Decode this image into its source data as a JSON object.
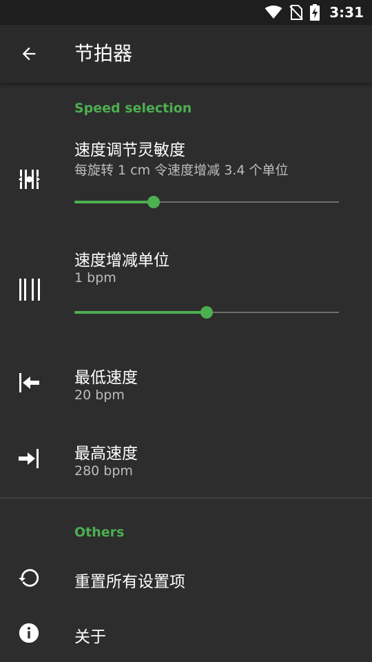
{
  "status_bar": {
    "time": "3:31",
    "icons": [
      "wifi-icon",
      "no-sim-icon",
      "battery-charging-icon"
    ]
  },
  "app_bar": {
    "back_icon": "arrow-left-icon",
    "title": "节拍器"
  },
  "sections": {
    "speed": {
      "header": "Speed selection",
      "sensitivity": {
        "icon": "sliders-icon",
        "title": "速度调节灵敏度",
        "summary": "每旋转 1 cm 令速度增减 3.4 个单位",
        "slider_fraction": 0.3
      },
      "step": {
        "icon": "bars-icon",
        "title": "速度增减单位",
        "summary": "1 bpm",
        "slider_fraction": 0.5
      },
      "min": {
        "icon": "arrow-to-left-icon",
        "title": "最低速度",
        "summary": "20 bpm"
      },
      "max": {
        "icon": "arrow-to-right-icon",
        "title": "最高速度",
        "summary": "280 bpm"
      }
    },
    "others": {
      "header": "Others",
      "reset": {
        "icon": "restore-icon",
        "title": "重置所有设置项"
      },
      "about": {
        "icon": "info-icon",
        "title": "关于"
      }
    }
  },
  "colors": {
    "accent": "#4caf50",
    "background": "#2d2d2d",
    "status_bar": "#1e1e1e",
    "track": "#6e6e6e"
  }
}
